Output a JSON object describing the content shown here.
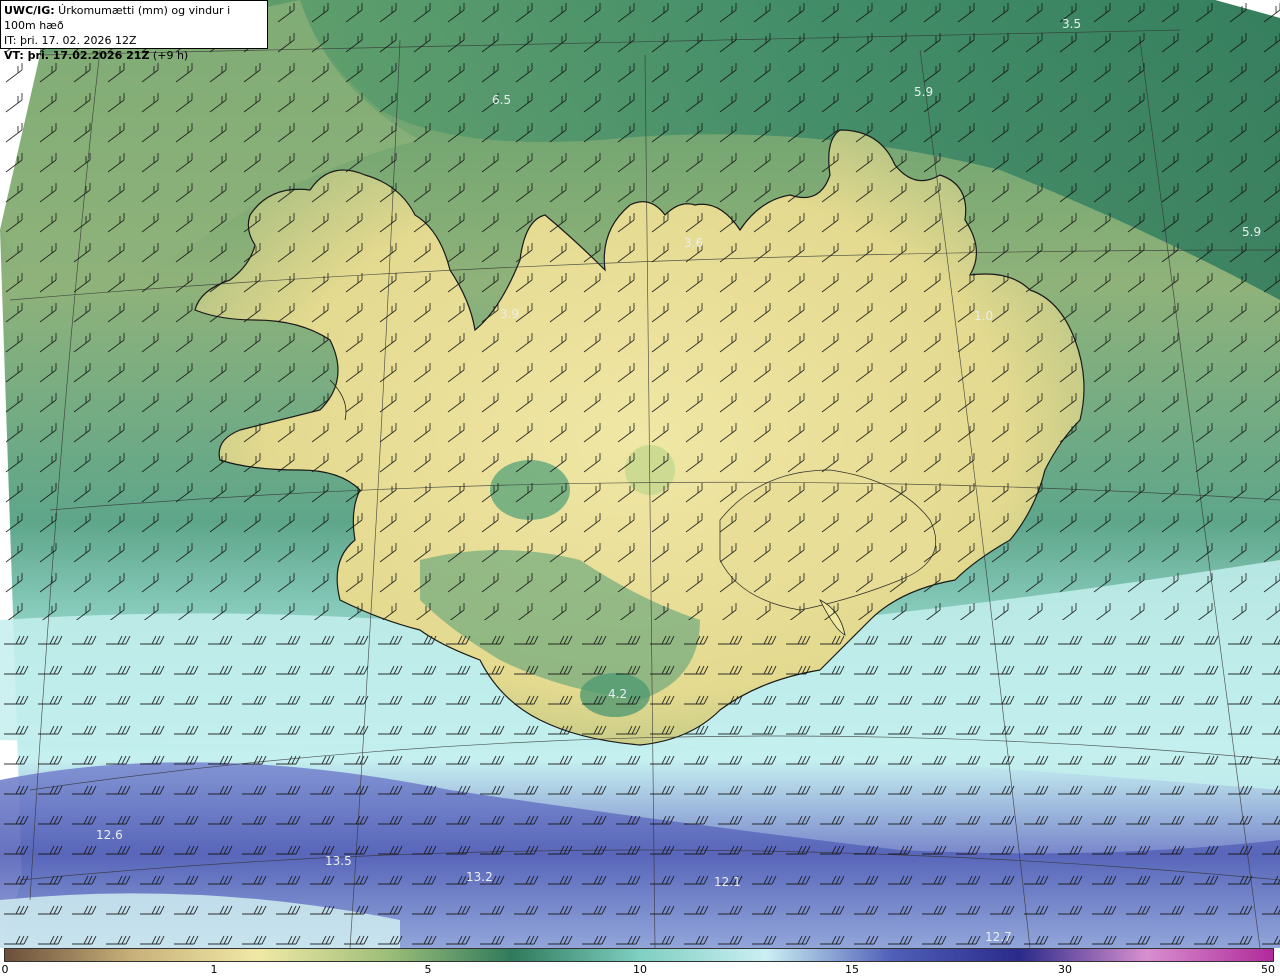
{
  "header": {
    "model": "UWC/IG:",
    "title": " Úrkomumætti (mm) og vindur i 100m hæð",
    "it_label": "IT:",
    "it_value": " þri. 17. 02. 2026 12Z",
    "vt_label": "VT:",
    "vt_value": " þri. 17.02.2026 21Z",
    "vt_lead": " (+9 h)"
  },
  "colorbar": {
    "ticks": [
      "0",
      "1",
      "5",
      "10",
      "15",
      "30",
      "50"
    ],
    "colors": [
      "#6b4f3a",
      "#c8b07a",
      "#f0e9a6",
      "#9fbf7a",
      "#2f7a5c",
      "#7fcfc2",
      "#cbeff3",
      "#4f5fb8",
      "#2a2a8a",
      "#d88fd0",
      "#b02a9a"
    ]
  },
  "map": {
    "colors": {
      "ocean_north": "#4f9a6e",
      "ocean_west": "#8fb27a",
      "land_yellow": "#eee39e",
      "ocean_south": "#bfeff0",
      "ocean_far_south": "#6e7ec8",
      "deep_blue": "#4a55b0",
      "coast_line": "#1a1a1a"
    },
    "value_labels": [
      "3.5",
      "6.5",
      "5.9",
      "5.9",
      "3.6",
      "3.9",
      "1.0",
      "4.2",
      "12.6",
      "13.5",
      "13.2",
      "12.1",
      "12.7"
    ]
  }
}
